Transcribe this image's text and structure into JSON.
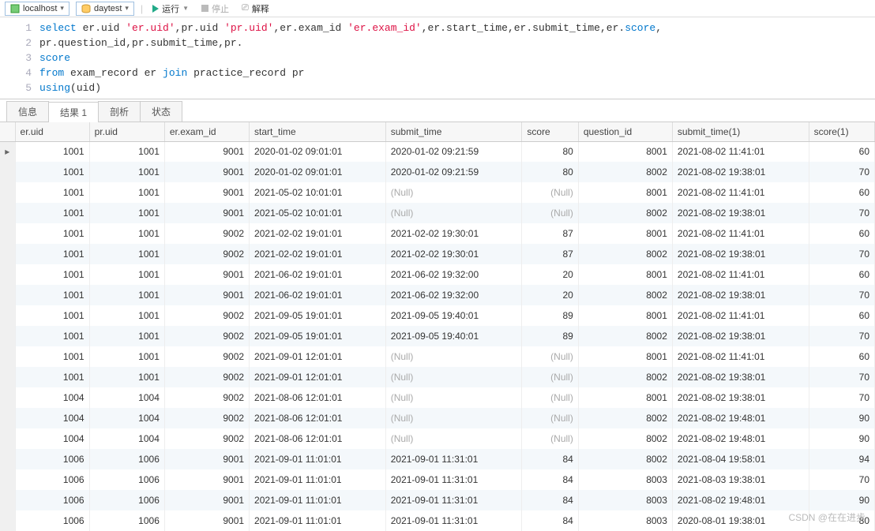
{
  "toolbar": {
    "connection": "localhost",
    "database": "daytest",
    "run": "运行",
    "stop": "停止",
    "explain": "解释"
  },
  "editor": {
    "lines": [
      {
        "n": "1",
        "segs": [
          {
            "t": "select ",
            "k": true
          },
          {
            "t": "er.uid "
          },
          {
            "t": "'er.uid'",
            "s": true
          },
          {
            "t": ",pr.uid "
          },
          {
            "t": "'pr.uid'",
            "s": true
          },
          {
            "t": ",er.exam_id "
          },
          {
            "t": "'er.exam_id'",
            "s": true
          },
          {
            "t": ",er.start_time,er.submit_time,er."
          },
          {
            "t": "score",
            "k": true
          },
          {
            "t": ","
          }
        ]
      },
      {
        "n": "2",
        "segs": [
          {
            "t": "pr.question_id,pr.submit_time,pr."
          }
        ]
      },
      {
        "n": "3",
        "segs": [
          {
            "t": "score",
            "k": true
          }
        ]
      },
      {
        "n": "4",
        "segs": [
          {
            "t": "from ",
            "k": true
          },
          {
            "t": "exam_record er "
          },
          {
            "t": "join ",
            "k": true
          },
          {
            "t": "practice_record pr"
          }
        ]
      },
      {
        "n": "5",
        "segs": [
          {
            "t": "using",
            "k": true
          },
          {
            "t": "(uid)"
          }
        ]
      }
    ]
  },
  "tabs": {
    "items": [
      "信息",
      "结果 1",
      "剖析",
      "状态"
    ],
    "active": 1
  },
  "grid": {
    "columns": [
      "er.uid",
      "pr.uid",
      "er.exam_id",
      "start_time",
      "submit_time",
      "score",
      "question_id",
      "submit_time(1)",
      "score(1)"
    ],
    "widths": [
      79,
      80,
      90,
      145,
      145,
      60,
      100,
      145,
      70
    ],
    "numeric": [
      true,
      true,
      true,
      false,
      false,
      true,
      true,
      false,
      true
    ],
    "rows": [
      [
        "1001",
        "1001",
        "9001",
        "2020-01-02 09:01:01",
        "2020-01-02 09:21:59",
        "80",
        "8001",
        "2021-08-02 11:41:01",
        "60"
      ],
      [
        "1001",
        "1001",
        "9001",
        "2020-01-02 09:01:01",
        "2020-01-02 09:21:59",
        "80",
        "8002",
        "2021-08-02 19:38:01",
        "70"
      ],
      [
        "1001",
        "1001",
        "9001",
        "2021-05-02 10:01:01",
        null,
        null,
        "8001",
        "2021-08-02 11:41:01",
        "60"
      ],
      [
        "1001",
        "1001",
        "9001",
        "2021-05-02 10:01:01",
        null,
        null,
        "8002",
        "2021-08-02 19:38:01",
        "70"
      ],
      [
        "1001",
        "1001",
        "9002",
        "2021-02-02 19:01:01",
        "2021-02-02 19:30:01",
        "87",
        "8001",
        "2021-08-02 11:41:01",
        "60"
      ],
      [
        "1001",
        "1001",
        "9002",
        "2021-02-02 19:01:01",
        "2021-02-02 19:30:01",
        "87",
        "8002",
        "2021-08-02 19:38:01",
        "70"
      ],
      [
        "1001",
        "1001",
        "9001",
        "2021-06-02 19:01:01",
        "2021-06-02 19:32:00",
        "20",
        "8001",
        "2021-08-02 11:41:01",
        "60"
      ],
      [
        "1001",
        "1001",
        "9001",
        "2021-06-02 19:01:01",
        "2021-06-02 19:32:00",
        "20",
        "8002",
        "2021-08-02 19:38:01",
        "70"
      ],
      [
        "1001",
        "1001",
        "9002",
        "2021-09-05 19:01:01",
        "2021-09-05 19:40:01",
        "89",
        "8001",
        "2021-08-02 11:41:01",
        "60"
      ],
      [
        "1001",
        "1001",
        "9002",
        "2021-09-05 19:01:01",
        "2021-09-05 19:40:01",
        "89",
        "8002",
        "2021-08-02 19:38:01",
        "70"
      ],
      [
        "1001",
        "1001",
        "9002",
        "2021-09-01 12:01:01",
        null,
        null,
        "8001",
        "2021-08-02 11:41:01",
        "60"
      ],
      [
        "1001",
        "1001",
        "9002",
        "2021-09-01 12:01:01",
        null,
        null,
        "8002",
        "2021-08-02 19:38:01",
        "70"
      ],
      [
        "1004",
        "1004",
        "9002",
        "2021-08-06 12:01:01",
        null,
        null,
        "8001",
        "2021-08-02 19:38:01",
        "70"
      ],
      [
        "1004",
        "1004",
        "9002",
        "2021-08-06 12:01:01",
        null,
        null,
        "8002",
        "2021-08-02 19:48:01",
        "90"
      ],
      [
        "1004",
        "1004",
        "9002",
        "2021-08-06 12:01:01",
        null,
        null,
        "8002",
        "2021-08-02 19:48:01",
        "90"
      ],
      [
        "1006",
        "1006",
        "9001",
        "2021-09-01 11:01:01",
        "2021-09-01 11:31:01",
        "84",
        "8002",
        "2021-08-04 19:58:01",
        "94"
      ],
      [
        "1006",
        "1006",
        "9001",
        "2021-09-01 11:01:01",
        "2021-09-01 11:31:01",
        "84",
        "8003",
        "2021-08-03 19:38:01",
        "70"
      ],
      [
        "1006",
        "1006",
        "9001",
        "2021-09-01 11:01:01",
        "2021-09-01 11:31:01",
        "84",
        "8003",
        "2021-08-02 19:48:01",
        "90"
      ],
      [
        "1006",
        "1006",
        "9001",
        "2021-09-01 11:01:01",
        "2021-09-01 11:31:01",
        "84",
        "8003",
        "2020-08-01 19:38:01",
        "80"
      ]
    ]
  },
  "watermark": "CSDN @在在进步",
  "null_text": "(Null)"
}
